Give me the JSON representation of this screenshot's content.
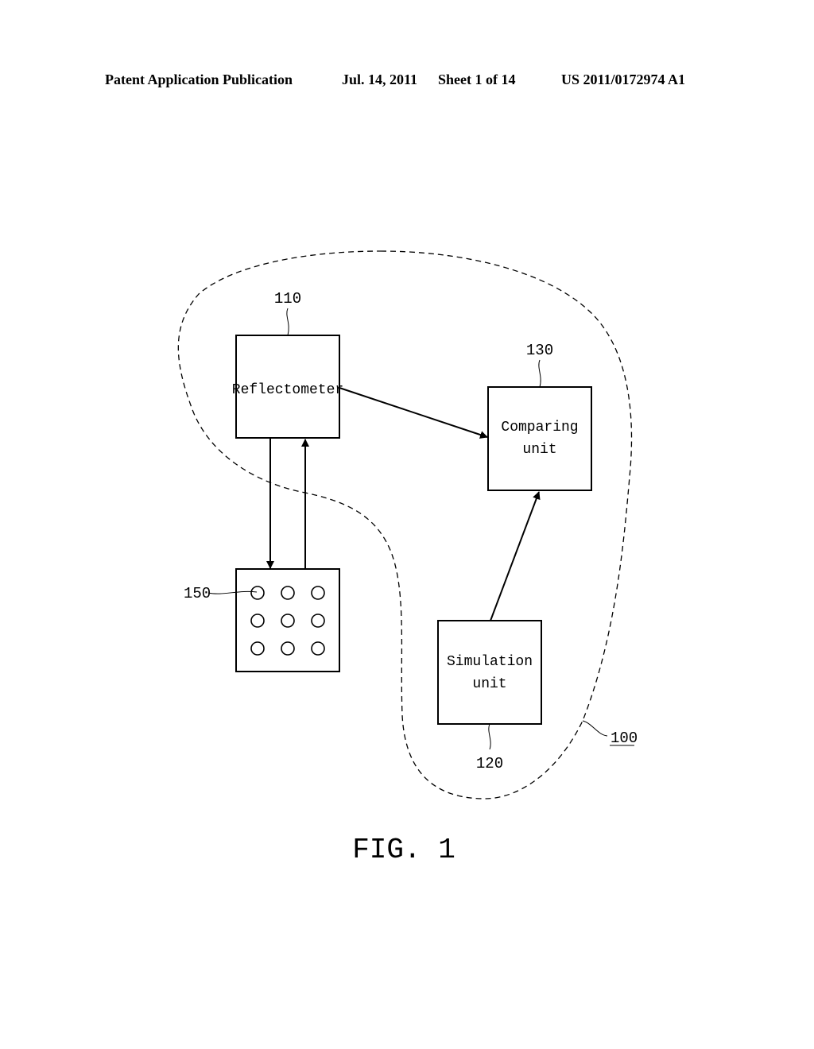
{
  "header": {
    "publication": "Patent Application Publication",
    "date": "Jul. 14, 2011",
    "sheet": "Sheet 1 of 14",
    "number": "US 2011/0172974 A1"
  },
  "figure": {
    "caption": "FIG. 1",
    "system": {
      "ref": "100",
      "outline": "dashed"
    },
    "blocks": {
      "reflectometer": {
        "ref": "110",
        "label_lines": [
          "Reflectometer"
        ]
      },
      "simulation": {
        "ref": "120",
        "label_lines": [
          "Simulation",
          "unit"
        ]
      },
      "comparing": {
        "ref": "130",
        "label_lines": [
          "Comparing",
          "unit"
        ]
      },
      "sample": {
        "ref": "150",
        "grid_rows": 3,
        "grid_cols": 3
      }
    },
    "connections": [
      {
        "from": "reflectometer",
        "to": "comparing"
      },
      {
        "from": "simulation",
        "to": "comparing"
      },
      {
        "from": "reflectometer",
        "to": "sample"
      },
      {
        "from": "sample",
        "to": "reflectometer"
      }
    ]
  }
}
